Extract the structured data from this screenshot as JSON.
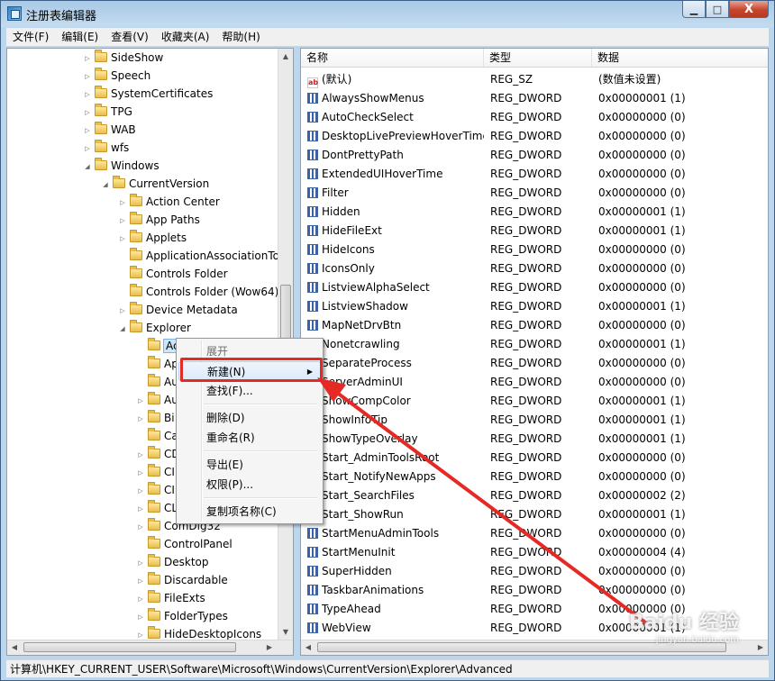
{
  "window": {
    "title": "注册表编辑器"
  },
  "window_buttons": {
    "minimize": "▁",
    "maximize": "□",
    "close": "X"
  },
  "menubar": [
    "文件(F)",
    "编辑(E)",
    "查看(V)",
    "收藏夹(A)",
    "帮助(H)"
  ],
  "tree": {
    "items": [
      {
        "label": "SideShow",
        "expander": "▷"
      },
      {
        "label": "Speech",
        "expander": "▷"
      },
      {
        "label": "SystemCertificates",
        "expander": "▷"
      },
      {
        "label": "TPG",
        "expander": "▷"
      },
      {
        "label": "WAB",
        "expander": "▷"
      },
      {
        "label": "wfs",
        "expander": "▷"
      },
      {
        "label": "Windows",
        "expander": "◢"
      },
      {
        "label": "CurrentVersion",
        "expander": "◢"
      },
      {
        "label": "Action Center",
        "expander": "▷"
      },
      {
        "label": "App Paths",
        "expander": "▷"
      },
      {
        "label": "Applets",
        "expander": "▷"
      },
      {
        "label": "ApplicationAssociationTo",
        "expander": ""
      },
      {
        "label": "Controls Folder",
        "expander": ""
      },
      {
        "label": "Controls Folder (Wow64)",
        "expander": ""
      },
      {
        "label": "Device Metadata",
        "expander": "▷"
      },
      {
        "label": "Explorer",
        "expander": "◢"
      },
      {
        "label": "Advanced",
        "expander": ""
      },
      {
        "label": "AppKey",
        "expander": ""
      },
      {
        "label": "AutoComplete",
        "expander": ""
      },
      {
        "label": "AutoplayHandlers",
        "expander": "▷"
      },
      {
        "label": "BitBucket",
        "expander": "▷"
      },
      {
        "label": "CabinetState",
        "expander": ""
      },
      {
        "label": "CD Burning",
        "expander": "▷"
      },
      {
        "label": "CLSID",
        "expander": "▷"
      },
      {
        "label": "CIDOpen",
        "expander": "▷"
      },
      {
        "label": "CLSID",
        "expander": "▷"
      },
      {
        "label": "ComDlg32",
        "expander": "▷"
      },
      {
        "label": "ControlPanel",
        "expander": ""
      },
      {
        "label": "Desktop",
        "expander": "▷"
      },
      {
        "label": "Discardable",
        "expander": "▷"
      },
      {
        "label": "FileExts",
        "expander": "▷"
      },
      {
        "label": "FolderTypes",
        "expander": "▷"
      },
      {
        "label": "HideDesktopIcons",
        "expander": "▷"
      }
    ],
    "hidden_label_override": [
      "Ac",
      "Ap",
      "Au",
      "Au",
      "Bi",
      "Ca",
      "CD",
      "CI",
      "CI",
      "CL"
    ]
  },
  "list": {
    "headers": {
      "name": "名称",
      "type": "类型",
      "data": "数据"
    },
    "rows": [
      {
        "name": "(默认)",
        "type": "REG_SZ",
        "data": "(数值未设置)",
        "icon": "string-value-icon"
      },
      {
        "name": "AlwaysShowMenus",
        "type": "REG_DWORD",
        "data": "0x00000001 (1)",
        "icon": "dword-value-icon"
      },
      {
        "name": "AutoCheckSelect",
        "type": "REG_DWORD",
        "data": "0x00000000 (0)",
        "icon": "dword-value-icon"
      },
      {
        "name": "DesktopLivePreviewHoverTime",
        "type": "REG_DWORD",
        "data": "0x00000000 (0)",
        "icon": "dword-value-icon"
      },
      {
        "name": "DontPrettyPath",
        "type": "REG_DWORD",
        "data": "0x00000000 (0)",
        "icon": "dword-value-icon"
      },
      {
        "name": "ExtendedUIHoverTime",
        "type": "REG_DWORD",
        "data": "0x00000000 (0)",
        "icon": "dword-value-icon"
      },
      {
        "name": "Filter",
        "type": "REG_DWORD",
        "data": "0x00000000 (0)",
        "icon": "dword-value-icon"
      },
      {
        "name": "Hidden",
        "type": "REG_DWORD",
        "data": "0x00000001 (1)",
        "icon": "dword-value-icon"
      },
      {
        "name": "HideFileExt",
        "type": "REG_DWORD",
        "data": "0x00000001 (1)",
        "icon": "dword-value-icon"
      },
      {
        "name": "HideIcons",
        "type": "REG_DWORD",
        "data": "0x00000000 (0)",
        "icon": "dword-value-icon"
      },
      {
        "name": "IconsOnly",
        "type": "REG_DWORD",
        "data": "0x00000000 (0)",
        "icon": "dword-value-icon"
      },
      {
        "name": "ListviewAlphaSelect",
        "type": "REG_DWORD",
        "data": "0x00000000 (0)",
        "icon": "dword-value-icon"
      },
      {
        "name": "ListviewShadow",
        "type": "REG_DWORD",
        "data": "0x00000001 (1)",
        "icon": "dword-value-icon"
      },
      {
        "name": "MapNetDrvBtn",
        "type": "REG_DWORD",
        "data": "0x00000000 (0)",
        "icon": "dword-value-icon"
      },
      {
        "name": "Nonetcrawling",
        "type": "REG_DWORD",
        "data": "0x00000001 (1)",
        "icon": "dword-value-icon"
      },
      {
        "name": "SeparateProcess",
        "type": "REG_DWORD",
        "data": "0x00000000 (0)",
        "icon": "dword-value-icon"
      },
      {
        "name": "ServerAdminUI",
        "type": "REG_DWORD",
        "data": "0x00000000 (0)",
        "icon": "dword-value-icon"
      },
      {
        "name": "ShowCompColor",
        "type": "REG_DWORD",
        "data": "0x00000001 (1)",
        "icon": "dword-value-icon"
      },
      {
        "name": "ShowInfoTip",
        "type": "REG_DWORD",
        "data": "0x00000001 (1)",
        "icon": "dword-value-icon"
      },
      {
        "name": "ShowTypeOverlay",
        "type": "REG_DWORD",
        "data": "0x00000001 (1)",
        "icon": "dword-value-icon"
      },
      {
        "name": "Start_AdminToolsRoot",
        "type": "REG_DWORD",
        "data": "0x00000000 (0)",
        "icon": "dword-value-icon"
      },
      {
        "name": "Start_NotifyNewApps",
        "type": "REG_DWORD",
        "data": "0x00000000 (0)",
        "icon": "dword-value-icon"
      },
      {
        "name": "Start_SearchFiles",
        "type": "REG_DWORD",
        "data": "0x00000002 (2)",
        "icon": "dword-value-icon"
      },
      {
        "name": "Start_ShowRun",
        "type": "REG_DWORD",
        "data": "0x00000001 (1)",
        "icon": "dword-value-icon"
      },
      {
        "name": "StartMenuAdminTools",
        "type": "REG_DWORD",
        "data": "0x00000000 (0)",
        "icon": "dword-value-icon"
      },
      {
        "name": "StartMenuInit",
        "type": "REG_DWORD",
        "data": "0x00000004 (4)",
        "icon": "dword-value-icon"
      },
      {
        "name": "SuperHidden",
        "type": "REG_DWORD",
        "data": "0x00000000 (0)",
        "icon": "dword-value-icon"
      },
      {
        "name": "TaskbarAnimations",
        "type": "REG_DWORD",
        "data": "0x00000000 (0)",
        "icon": "dword-value-icon"
      },
      {
        "name": "TypeAhead",
        "type": "REG_DWORD",
        "data": "0x00000000 (0)",
        "icon": "dword-value-icon"
      },
      {
        "name": "WebView",
        "type": "REG_DWORD",
        "data": "0x00000001 (1)",
        "icon": "dword-value-icon"
      }
    ]
  },
  "context_menu": {
    "items": [
      {
        "label": "展开",
        "disabled": true
      },
      {
        "label": "新建(N)",
        "submenu": "▶",
        "highlighted": true
      },
      {
        "label": "查找(F)..."
      },
      {
        "separator": true
      },
      {
        "label": "删除(D)"
      },
      {
        "label": "重命名(R)"
      },
      {
        "separator": true
      },
      {
        "label": "导出(E)"
      },
      {
        "label": "权限(P)..."
      },
      {
        "separator": true
      },
      {
        "label": "复制项名称(C)"
      }
    ]
  },
  "statusbar": {
    "path": "计算机\\HKEY_CURRENT_USER\\Software\\Microsoft\\Windows\\CurrentVersion\\Explorer\\Advanced"
  },
  "watermark": {
    "main": "Baidu 经验",
    "sub": "jingyan.baidu.com"
  },
  "colors": {
    "annotation": "#e52925",
    "selection": "#cde6f7",
    "frame": "#bcd6ee"
  }
}
